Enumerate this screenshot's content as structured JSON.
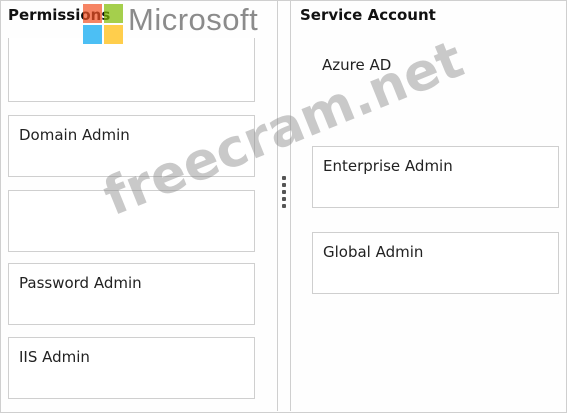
{
  "permissions": {
    "header": "Permissions",
    "items": [
      "",
      "Domain Admin",
      "",
      "Password Admin",
      "IIS Admin"
    ]
  },
  "service_account": {
    "header": "Service Account",
    "label": "Azure AD",
    "slots": [
      "Enterprise Admin",
      "Global Admin"
    ]
  },
  "watermark": {
    "brand": "Microsoft",
    "site": "freecram.net"
  },
  "colors": {
    "border": "#cfcfcf",
    "logo_red": "#f25022",
    "logo_green": "#7fba00",
    "logo_blue": "#00a4ef",
    "logo_yellow": "#ffb900"
  },
  "icons": {
    "grip": "drag-handle-icon",
    "logo": "microsoft-logo-icon"
  }
}
